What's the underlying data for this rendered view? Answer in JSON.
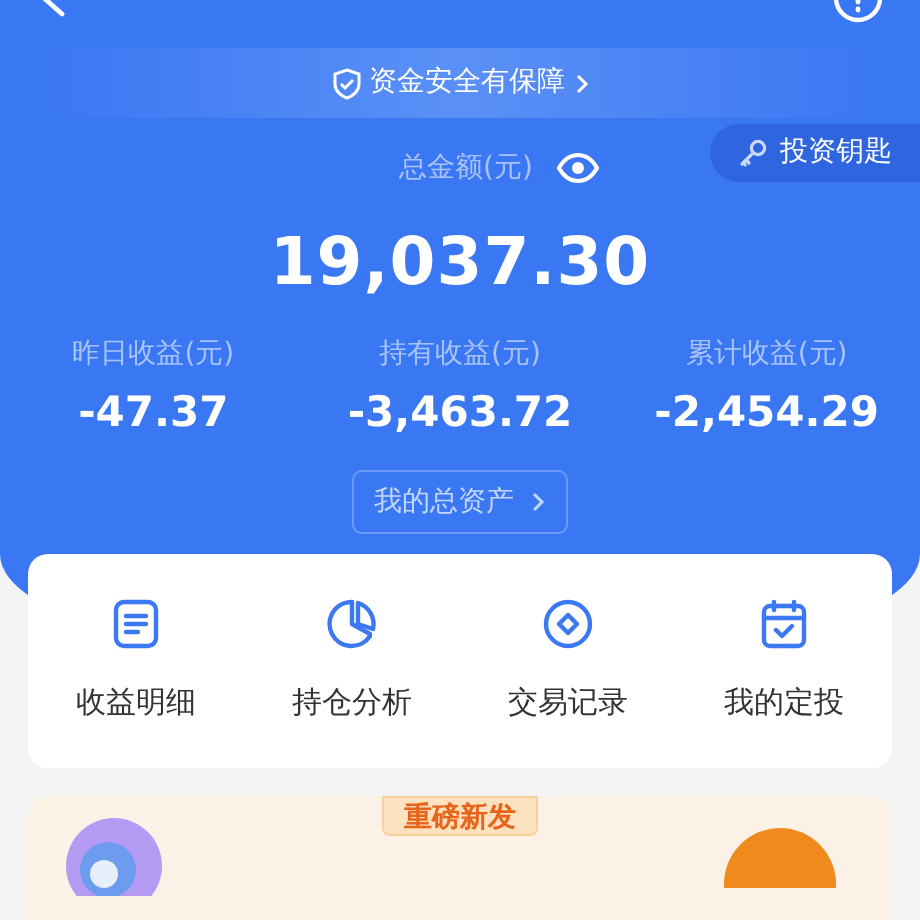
{
  "safety_banner": {
    "text": "资金安全有保障"
  },
  "total": {
    "label": "总金额(元)",
    "amount": "19,037.30"
  },
  "key_button": {
    "label": "投资钥匙"
  },
  "stats": [
    {
      "label": "昨日收益(元)",
      "value": "-47.37"
    },
    {
      "label": "持有收益(元)",
      "value": "-3,463.72"
    },
    {
      "label": "累计收益(元)",
      "value": "-2,454.29"
    }
  ],
  "assets_button": {
    "label": "我的总资产"
  },
  "shortcuts": [
    {
      "kind": "detail",
      "label": "收益明细"
    },
    {
      "kind": "analysis",
      "label": "持仓分析"
    },
    {
      "kind": "records",
      "label": "交易记录"
    },
    {
      "kind": "plan",
      "label": "我的定投"
    }
  ],
  "promo": {
    "badge": "重磅新发"
  }
}
